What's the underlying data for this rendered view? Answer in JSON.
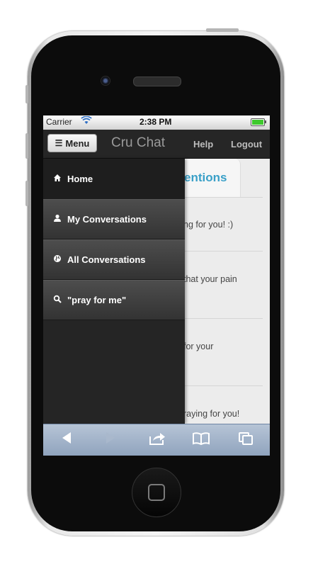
{
  "statusbar": {
    "carrier": "Carrier",
    "time": "2:38 PM"
  },
  "topbar": {
    "menu_label": "Menu",
    "title": "Cru Chat",
    "help_label": "Help",
    "logout_label": "Logout"
  },
  "drawer": {
    "items": [
      {
        "label": "Home",
        "icon": "home-icon"
      },
      {
        "label": "My Conversations",
        "icon": "person-icon"
      },
      {
        "label": "All Conversations",
        "icon": "globe-icon"
      },
      {
        "label": "\"pray for me\"",
        "icon": "search-icon"
      }
    ]
  },
  "content": {
    "tab_label": "entions",
    "rows": [
      {
        "text": "ng for you! :)"
      },
      {
        "text": " that your pain"
      },
      {
        "text": "for your"
      },
      {
        "text": "raying for you!"
      }
    ]
  },
  "bottom_toolbar": {
    "icons": [
      "back-icon",
      "forward-icon",
      "share-icon",
      "bookmarks-icon",
      "tabs-icon"
    ]
  },
  "colors": {
    "accent": "#3aa0c8",
    "topbar": "#262626",
    "drawer": "#252525",
    "toolbar": "#9fb1c8"
  }
}
